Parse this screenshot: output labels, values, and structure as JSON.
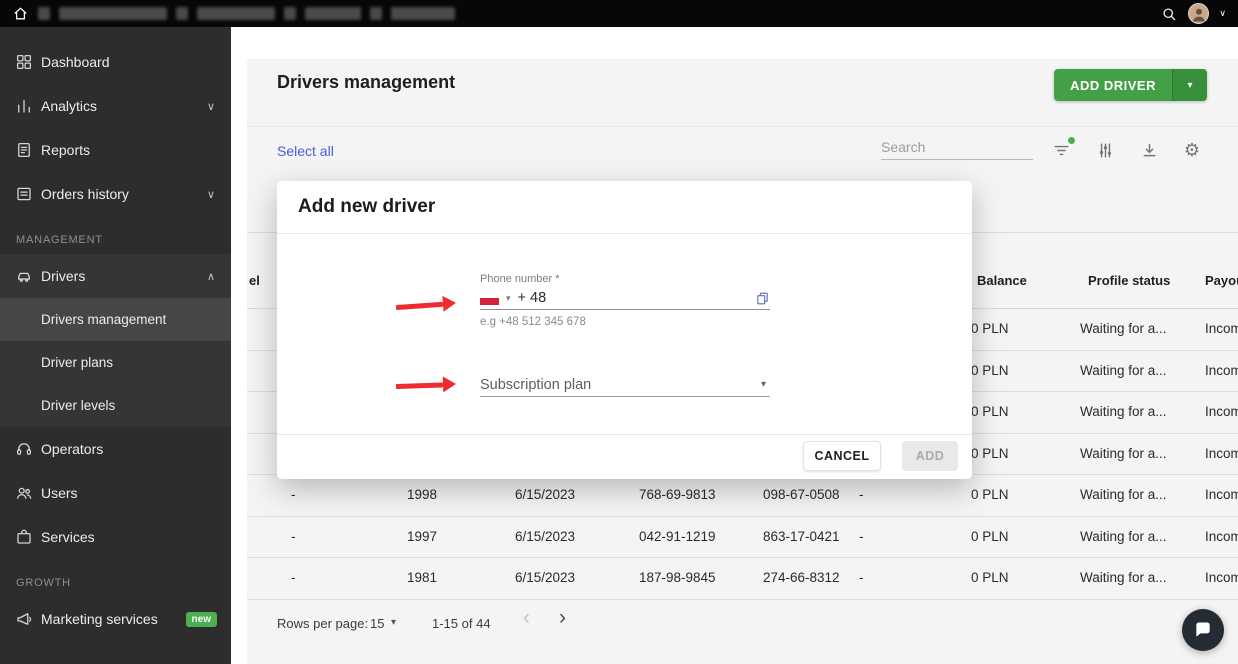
{
  "icons": {
    "gear": "⚙",
    "caret_down": "▾",
    "chevron_down": "∨",
    "chevron_up": "∧",
    "page_prev": "‹",
    "page_next": "›"
  },
  "colors": {
    "primary_green": "#43a047",
    "link_blue": "#4a5ae0",
    "arrow_red": "#ee2b2e",
    "badge_green": "#4caf50"
  },
  "sidebar": {
    "items": [
      {
        "label": "Dashboard"
      },
      {
        "label": "Analytics"
      },
      {
        "label": "Reports"
      },
      {
        "label": "Orders history"
      },
      {
        "label": "MANAGEMENT"
      },
      {
        "label": "Drivers"
      },
      {
        "label": "Drivers management"
      },
      {
        "label": "Driver plans"
      },
      {
        "label": "Driver levels"
      },
      {
        "label": "Operators"
      },
      {
        "label": "Users"
      },
      {
        "label": "Services"
      },
      {
        "label": "GROWTH"
      },
      {
        "label": "Marketing services",
        "badge": "new"
      }
    ]
  },
  "header": {
    "title": "Drivers management",
    "add_driver": "ADD DRIVER"
  },
  "toolbar": {
    "select_all": "Select all",
    "search_placeholder": "Search"
  },
  "table": {
    "headers": [
      "el",
      "Balance",
      "Profile status",
      "Payout"
    ],
    "rows": [
      [
        "",
        "",
        "",
        "",
        "",
        "",
        "0 PLN",
        "Waiting for a...",
        "Incomplete"
      ],
      [
        "",
        "",
        "",
        "",
        "",
        "",
        "0 PLN",
        "Waiting for a...",
        "Incomplete"
      ],
      [
        "",
        "",
        "",
        "",
        "",
        "",
        "0 PLN",
        "Waiting for a...",
        "Incomplete"
      ],
      [
        "",
        "",
        "",
        "",
        "",
        "",
        "0 PLN",
        "Waiting for a...",
        "Incomplete"
      ],
      [
        "-",
        "1998",
        "6/15/2023",
        "768-69-9813",
        "098-67-0508",
        "-",
        "0 PLN",
        "Waiting for a...",
        "Incomplete"
      ],
      [
        "-",
        "1997",
        "6/15/2023",
        "042-91-1219",
        "863-17-0421",
        "-",
        "0 PLN",
        "Waiting for a...",
        "Incomplete"
      ],
      [
        "-",
        "1981",
        "6/15/2023",
        "187-98-9845",
        "274-66-8312",
        "-",
        "0 PLN",
        "Waiting for a...",
        "Incomplete"
      ]
    ]
  },
  "pagination": {
    "rows_per_page_label": "Rows per page:",
    "rows_per_page": "15",
    "range": "1-15 of 44"
  },
  "modal": {
    "title": "Add new driver",
    "phone": {
      "label": "Phone number *",
      "dial_code": "+ 48",
      "hint": "e.g +48 512 345 678"
    },
    "subscription": {
      "placeholder": "Subscription plan"
    },
    "cancel": "CANCEL",
    "add": "ADD"
  }
}
